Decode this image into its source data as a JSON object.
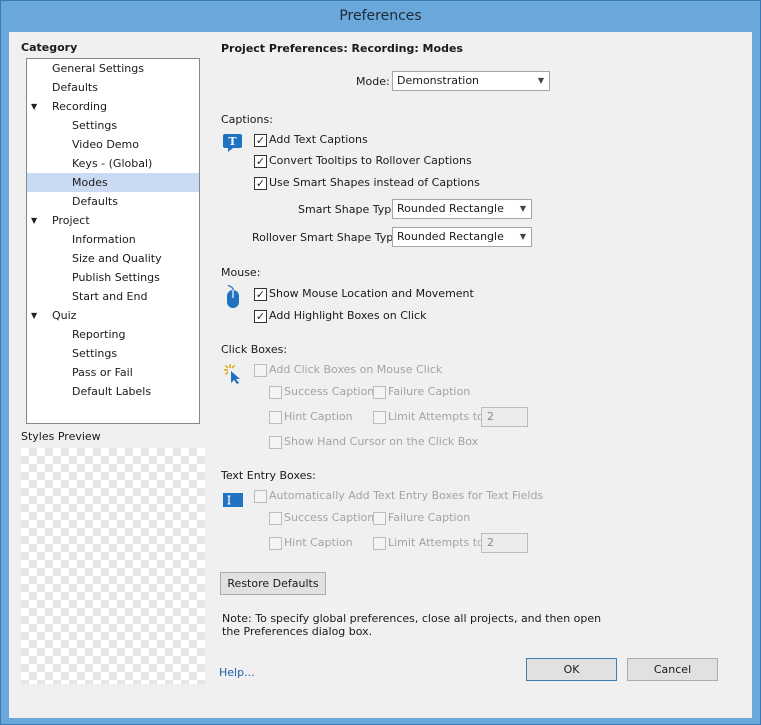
{
  "window": {
    "title": "Preferences"
  },
  "sidebar": {
    "category_title": "Category",
    "items": [
      {
        "label": "General Settings",
        "level": 0
      },
      {
        "label": "Defaults",
        "level": 0
      },
      {
        "label": "Recording",
        "level": 0,
        "expanded": true
      },
      {
        "label": "Settings",
        "level": 1
      },
      {
        "label": "Video Demo",
        "level": 1
      },
      {
        "label": "Keys - (Global)",
        "level": 1
      },
      {
        "label": "Modes",
        "level": 1,
        "selected": true
      },
      {
        "label": "Defaults",
        "level": 1
      },
      {
        "label": "Project",
        "level": 0,
        "expanded": true
      },
      {
        "label": "Information",
        "level": 1
      },
      {
        "label": "Size and Quality",
        "level": 1
      },
      {
        "label": "Publish Settings",
        "level": 1
      },
      {
        "label": "Start and End",
        "level": 1
      },
      {
        "label": "Quiz",
        "level": 0,
        "expanded": true
      },
      {
        "label": "Reporting",
        "level": 1
      },
      {
        "label": "Settings",
        "level": 1
      },
      {
        "label": "Pass or Fail",
        "level": 1
      },
      {
        "label": "Default Labels",
        "level": 1
      }
    ],
    "styles_preview_label": "Styles Preview"
  },
  "main": {
    "heading": "Project Preferences: Recording: Modes",
    "mode_label": "Mode:",
    "mode_value": "Demonstration",
    "captions": {
      "title": "Captions:",
      "add_text_captions": {
        "label": "Add Text Captions",
        "checked": true
      },
      "convert_tooltips": {
        "label": "Convert Tooltips to Rollover Captions",
        "checked": true
      },
      "use_smart_shapes": {
        "label": "Use Smart Shapes instead of Captions",
        "checked": true
      },
      "smart_shape_type_label": "Smart Shape Type",
      "smart_shape_type_value": "Rounded Rectangle",
      "rollover_shape_type_label": "Rollover Smart Shape Type",
      "rollover_shape_type_value": "Rounded Rectangle"
    },
    "mouse": {
      "title": "Mouse:",
      "show_mouse": {
        "label": "Show Mouse Location and Movement",
        "checked": true
      },
      "add_highlight": {
        "label": "Add Highlight Boxes on Click",
        "checked": true
      }
    },
    "click_boxes": {
      "title": "Click Boxes:",
      "add_click_boxes": "Add Click Boxes on Mouse Click",
      "success_caption": "Success Caption",
      "failure_caption": "Failure Caption",
      "hint_caption": "Hint Caption",
      "limit_attempts": "Limit Attempts to",
      "limit_value": "2",
      "show_hand_cursor": "Show Hand Cursor on the Click Box"
    },
    "text_entry": {
      "title": "Text Entry Boxes:",
      "auto_add": "Automatically Add Text Entry Boxes for Text Fields",
      "success_caption": "Success Caption",
      "failure_caption": "Failure Caption",
      "hint_caption": "Hint Caption",
      "limit_attempts": "Limit Attempts to",
      "limit_value": "2"
    },
    "restore_defaults": "Restore Defaults",
    "note_line1": "Note: To specify global preferences, close all projects, and then open",
    "note_line2": "the Preferences dialog box."
  },
  "footer": {
    "help": "Help...",
    "ok": "OK",
    "cancel": "Cancel"
  }
}
